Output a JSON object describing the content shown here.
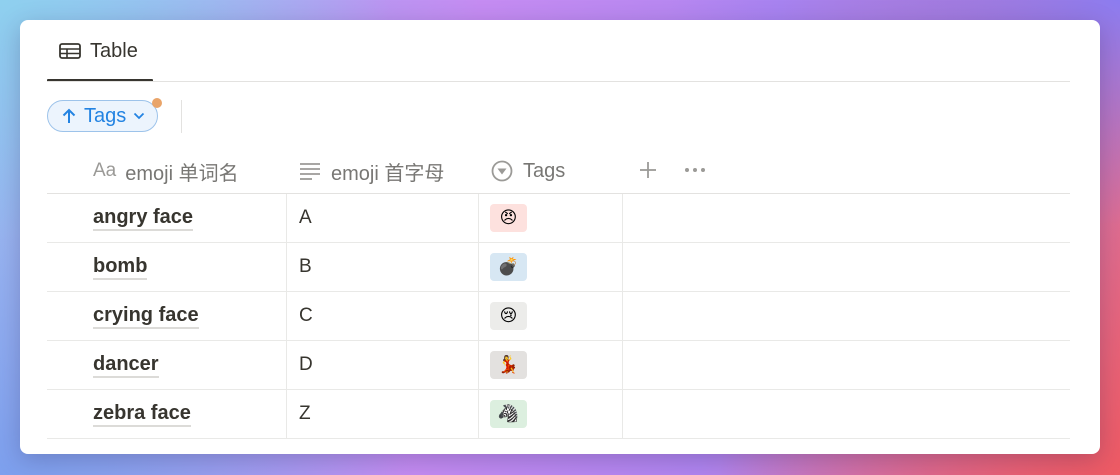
{
  "view": {
    "tab_label": "Table",
    "tab_icon": "table-icon"
  },
  "sort": {
    "label": "Tags",
    "direction_icon": "arrow-up-icon",
    "dropdown_icon": "chevron-down-icon",
    "indicator_color": "#e9a469",
    "accent_color": "#2383e2"
  },
  "columns": [
    {
      "prefix": "Aa",
      "label": "emoji 单词名",
      "icon": "title-text-icon"
    },
    {
      "label": "emoji 首字母",
      "icon": "text-lines-icon"
    },
    {
      "label": "Tags",
      "icon": "select-circle-icon"
    }
  ],
  "column_actions": {
    "add_icon": "plus-icon",
    "more_icon": "more-dots-icon"
  },
  "rows": [
    {
      "name": "angry face",
      "letter": "A",
      "tag": "😠",
      "tag_color": "#fde1de"
    },
    {
      "name": "bomb",
      "letter": "B",
      "tag": "💣",
      "tag_color": "#d7e7f3"
    },
    {
      "name": "crying face",
      "letter": "C",
      "tag": "😢",
      "tag_color": "#ececea"
    },
    {
      "name": "dancer",
      "letter": "D",
      "tag": "💃",
      "tag_color": "#e3e1df"
    },
    {
      "name": "zebra face",
      "letter": "Z",
      "tag": "🦓",
      "tag_color": "#dcefdf"
    }
  ]
}
